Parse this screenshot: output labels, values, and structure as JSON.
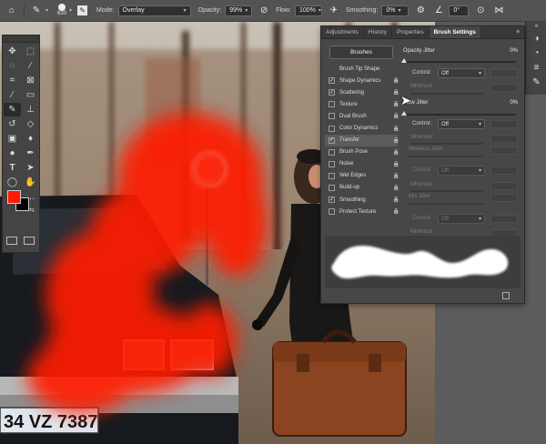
{
  "options_bar": {
    "brush_size": "630",
    "mode_label": "Mode:",
    "mode_value": "Overlay",
    "opacity_label": "Opacity:",
    "opacity_value": "99%",
    "flow_label": "Flow:",
    "flow_value": "100%",
    "smoothing_label": "Smoothing:",
    "smoothing_value": "0%",
    "angle_value": "0°"
  },
  "panel": {
    "tabs": [
      "Adjustments",
      "History",
      "Properties",
      "Brush Settings"
    ],
    "active_tab": "Brush Settings",
    "brushes_button": "Brushes",
    "brush_list": [
      {
        "label": "Brush Tip Shape",
        "checkbox": false,
        "checked": false,
        "lock": false
      },
      {
        "label": "Shape Dynamics",
        "checkbox": true,
        "checked": true,
        "lock": true
      },
      {
        "label": "Scattering",
        "checkbox": true,
        "checked": true,
        "lock": true
      },
      {
        "label": "Texture",
        "checkbox": true,
        "checked": false,
        "lock": true
      },
      {
        "label": "Dual Brush",
        "checkbox": true,
        "checked": false,
        "lock": true
      },
      {
        "label": "Color Dynamics",
        "checkbox": true,
        "checked": false,
        "lock": true
      },
      {
        "label": "Transfer",
        "checkbox": true,
        "checked": true,
        "lock": true
      },
      {
        "label": "Brush Pose",
        "checkbox": true,
        "checked": false,
        "lock": true
      },
      {
        "label": "Noise",
        "checkbox": true,
        "checked": false,
        "lock": true
      },
      {
        "label": "Wet Edges",
        "checkbox": true,
        "checked": false,
        "lock": true
      },
      {
        "label": "Build-up",
        "checkbox": true,
        "checked": false,
        "lock": true
      },
      {
        "label": "Smoothing",
        "checkbox": true,
        "checked": true,
        "lock": true
      },
      {
        "label": "Protect Texture",
        "checkbox": true,
        "checked": false,
        "lock": true
      }
    ],
    "opacity_jitter_label": "Opacity Jitter",
    "opacity_jitter_value": "0%",
    "control_label": "Control:",
    "control1_value": "Off",
    "minimum_label": "Minimum",
    "flow_jitter_label": "Flow Jitter",
    "flow_jitter_value": "0%",
    "control2_value": "Off",
    "wetness_jitter_label": "Wetness Jitter",
    "mix_jitter_label": "Mix Jitter",
    "control3_value": "Off",
    "control4_value": "Off"
  },
  "canvas": {
    "license_plate": "34 VZ 7387"
  },
  "colors": {
    "foreground": "#ff1a00",
    "background": "#000000",
    "panel_bg": "#474747",
    "accent_red": "#ff1a00"
  }
}
